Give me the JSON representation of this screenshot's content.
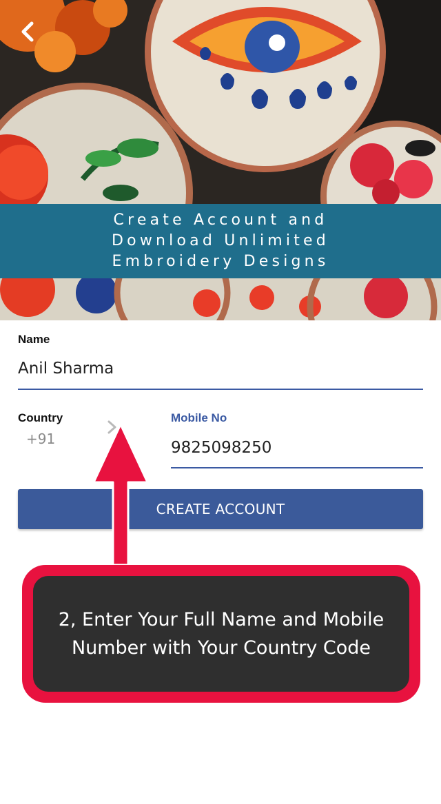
{
  "hero": {
    "banner_lines": [
      "Create Account and",
      "Download Unlimited",
      "Embroidery Designs"
    ],
    "banner_color": "#1f6e8c",
    "back_icon": "chevron-left-icon"
  },
  "form": {
    "name_label": "Name",
    "name_value": "Anil Sharma",
    "country_label": "Country",
    "country_code": "+91",
    "mobile_label": "Mobile No",
    "mobile_value": "9825098250",
    "accent_color": "#3b5aa3"
  },
  "create_button": {
    "label": "CREATE ACCOUNT",
    "color": "#3b5a9a"
  },
  "tutorial": {
    "lines": [
      "2, Enter Your Full Name and Mobile",
      "Number with Your Country Code"
    ],
    "highlight_color": "#e8123f",
    "box_color": "#2f2f2f"
  }
}
